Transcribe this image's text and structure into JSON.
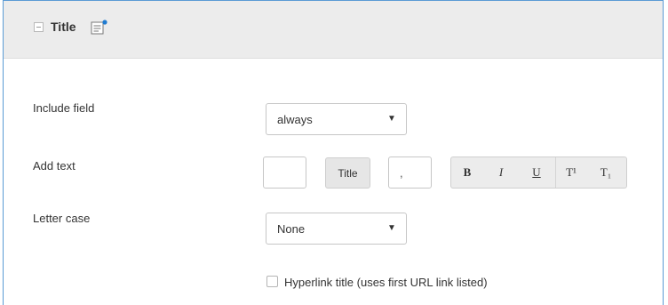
{
  "header": {
    "title": "Title"
  },
  "fields": {
    "include_field": {
      "label": "Include field",
      "value": "always"
    },
    "add_text": {
      "label": "Add text",
      "prefix_value": "",
      "title_chip": "Title",
      "suffix_value": ",",
      "format_buttons": {
        "bold": "B",
        "italic": "I",
        "underline": "U",
        "superscript": "T¹",
        "subscript": "T₁"
      }
    },
    "letter_case": {
      "label": "Letter case",
      "value": "None"
    },
    "hyperlink": {
      "label": "Hyperlink title (uses first URL link listed)",
      "checked": false
    }
  },
  "icons": {
    "caret": "▼"
  },
  "colors": {
    "panel_border": "#5b9bd5",
    "header_bg": "#ececec",
    "note_dot": "#1f7bd1"
  }
}
